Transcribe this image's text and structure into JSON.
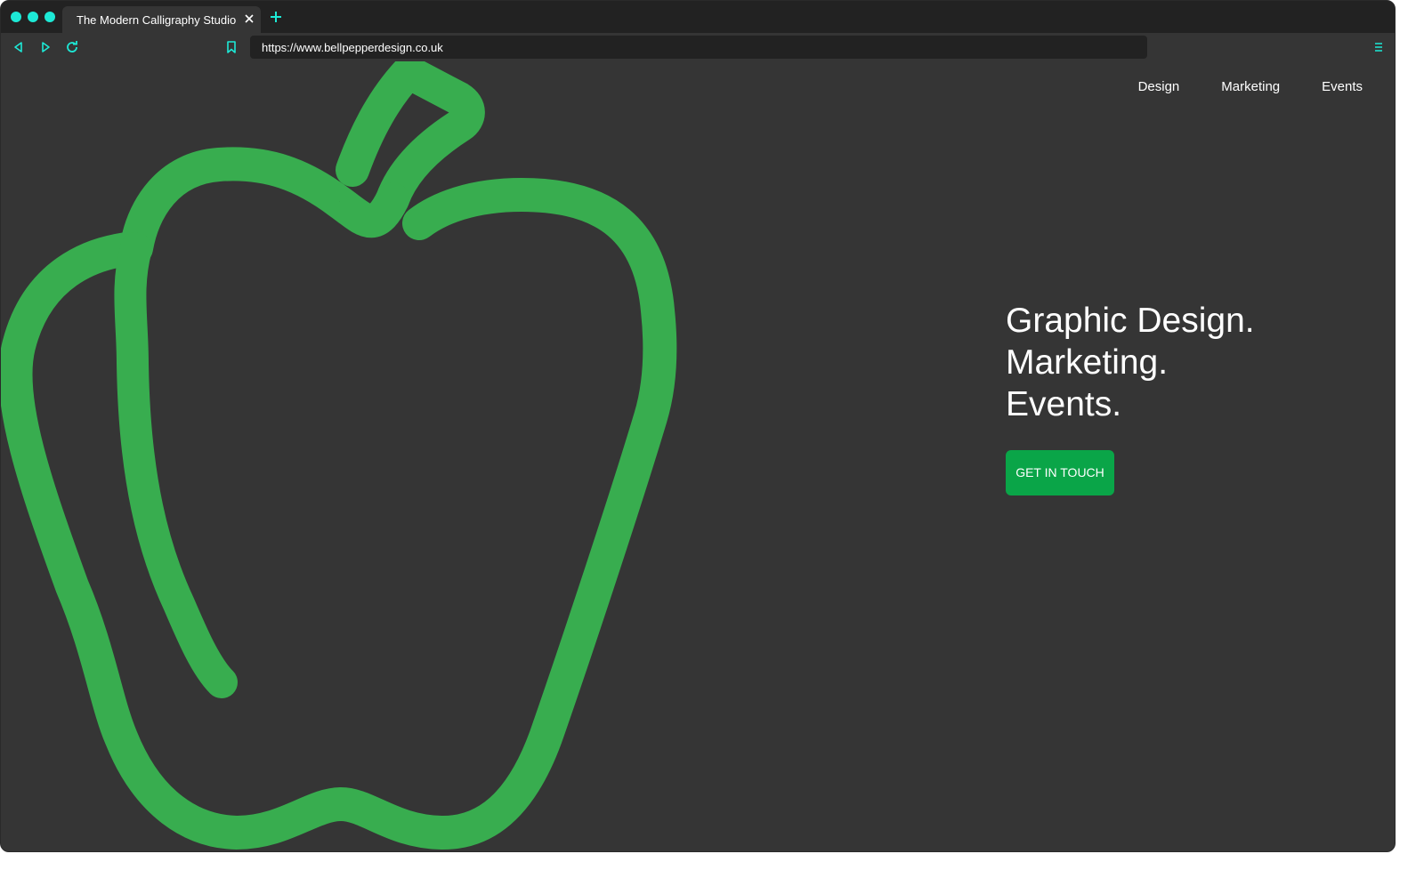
{
  "colors": {
    "accent": "#1de9d6",
    "page_background": "#353535",
    "chrome_background": "#222222",
    "pepper_green": "#38ad4f",
    "cta_green": "#0aa548"
  },
  "browser": {
    "tab": {
      "title": "The Modern Calligraphy Studio",
      "close_icon": "close-icon"
    },
    "new_tab_icon": "plus-icon",
    "toolbar": {
      "back_icon": "chevron-left-icon",
      "forward_icon": "chevron-right-icon",
      "reload_icon": "reload-icon",
      "bookmark_icon": "bookmark-icon",
      "menu_icon": "menu-icon"
    },
    "url": "https://www.bellpepperdesign.co.uk"
  },
  "site": {
    "logo_icon": "bell-pepper-icon",
    "nav": {
      "items": [
        "Design",
        "Marketing",
        "Events"
      ]
    },
    "hero": {
      "lines": [
        "Graphic Design.",
        "Marketing.",
        "Events."
      ],
      "cta_label": "GET IN TOUCH"
    }
  }
}
